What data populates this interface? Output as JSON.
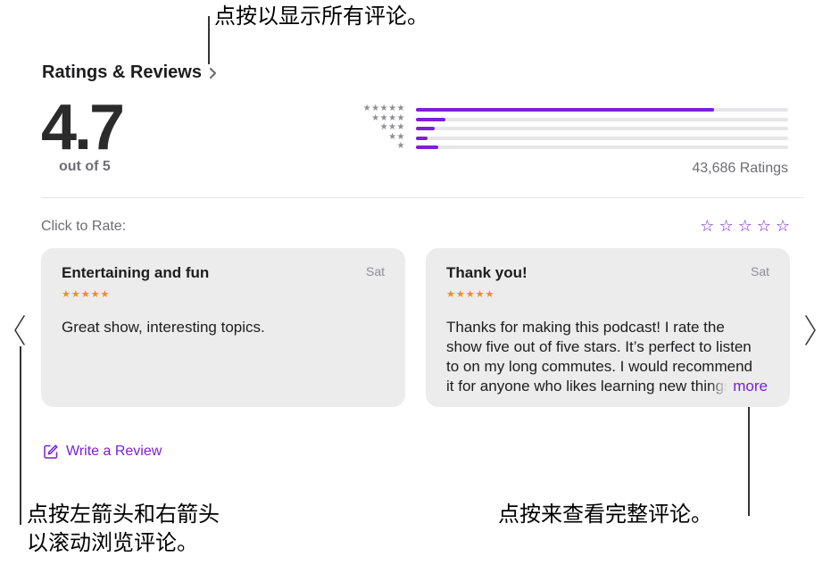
{
  "callouts": {
    "top": "点按以显示所有评论。",
    "left_line1": "点按左箭头和右箭头",
    "left_line2": "以滚动浏览评论。",
    "right": "点按来查看完整评论。"
  },
  "header": {
    "title": "Ratings & Reviews"
  },
  "summary": {
    "score": "4.7",
    "out_of": "out of 5",
    "ratings_count": "43,686 Ratings",
    "distribution": [
      {
        "stars": "★★★★★",
        "fraction": 0.8
      },
      {
        "stars": "★★★★",
        "fraction": 0.08
      },
      {
        "stars": "★★★",
        "fraction": 0.05
      },
      {
        "stars": "★★",
        "fraction": 0.03
      },
      {
        "stars": "★",
        "fraction": 0.06
      }
    ]
  },
  "rate": {
    "label": "Click to Rate:",
    "star": "☆"
  },
  "reviews": [
    {
      "title": "Entertaining and fun",
      "date": "Sat",
      "stars": "★★★★★",
      "body": "Great show, interesting topics."
    },
    {
      "title": "Thank you!",
      "date": "Sat",
      "stars": "★★★★★",
      "body": "Thanks for making this podcast! I rate the show five out of five stars. It’s perfect to listen to on my long commutes. I would recommend it for anyone who likes learning new things.",
      "more": "more"
    }
  ],
  "write_review": {
    "label": "Write a Review"
  },
  "colors": {
    "accent": "#7a20d6",
    "stars": "#ff8a00",
    "card": "#ececec"
  }
}
